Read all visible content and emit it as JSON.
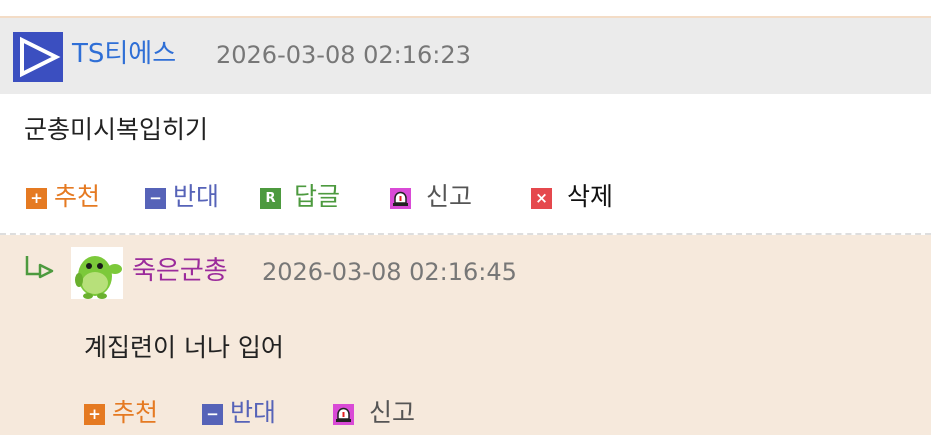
{
  "post": {
    "author": "TS티에스",
    "timestamp": "2026-03-08 02:16:23",
    "content": "군총미시복입히기",
    "actions": {
      "recommend": "추천",
      "oppose": "반대",
      "reply": "답글",
      "report": "신고",
      "delete": "삭제"
    }
  },
  "reply": {
    "author": "죽은군총",
    "timestamp": "2026-03-08 02:16:45",
    "content": "계집련이 너나 입어",
    "actions": {
      "recommend": "추천",
      "oppose": "반대",
      "report": "신고"
    }
  },
  "icons": {
    "recommend": "plus-icon",
    "oppose": "minus-icon",
    "reply": "reply-r-icon",
    "report": "siren-icon",
    "delete": "x-icon"
  },
  "colors": {
    "author_blue": "#2f6fd6",
    "reply_author_purple": "#9b2b9b",
    "recommend_orange": "#e57a22",
    "oppose_blue": "#5663b8",
    "reply_green": "#4d9a3f",
    "report_purple": "#a436b0",
    "delete_red": "#e5484d",
    "reply_bg": "#f6e9dc",
    "header_bg": "#ebebeb"
  }
}
